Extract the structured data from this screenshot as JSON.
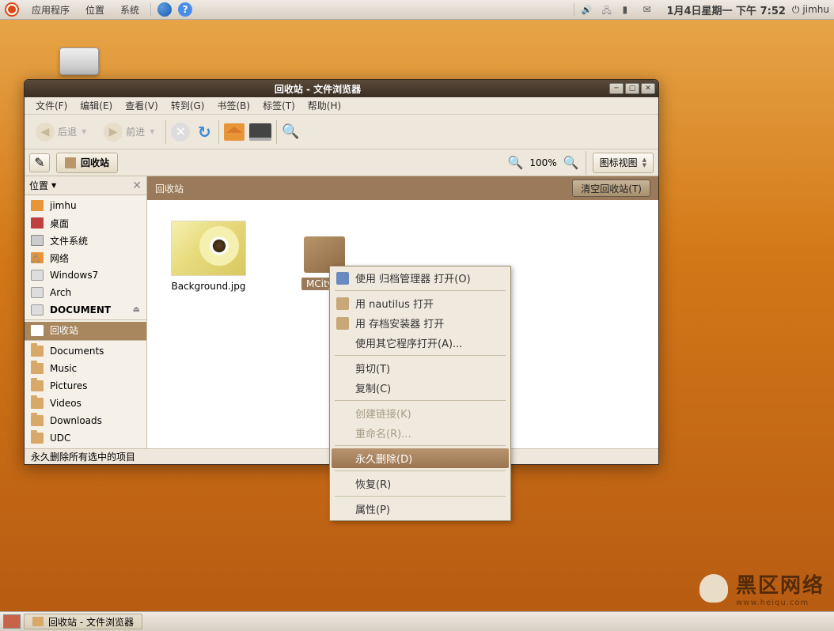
{
  "top_panel": {
    "menus": [
      "应用程序",
      "位置",
      "系统"
    ],
    "clock": "1月4日星期一 下午 7:52",
    "user": "jimhu"
  },
  "window": {
    "title": "回收站 - 文件浏览器",
    "menubar": {
      "file": "文件(F)",
      "edit": "编辑(E)",
      "view": "查看(V)",
      "go": "转到(G)",
      "bookmarks": "书签(B)",
      "tabs": "标签(T)",
      "help": "帮助(H)"
    },
    "toolbar": {
      "back": "后退",
      "forward": "前进"
    },
    "location_button": "回收站",
    "zoom": "100%",
    "view_mode": "图标视图",
    "sidebar": {
      "header": "位置",
      "items": [
        {
          "label": "jimhu",
          "icon": "home"
        },
        {
          "label": "桌面",
          "icon": "desk"
        },
        {
          "label": "文件系统",
          "icon": "fs"
        },
        {
          "label": "网络",
          "icon": "net"
        },
        {
          "label": "Windows7",
          "icon": "disk"
        },
        {
          "label": "Arch",
          "icon": "disk"
        },
        {
          "label": "DOCUMENT",
          "icon": "disk",
          "bold": true,
          "eject": true,
          "sep_after": true
        },
        {
          "label": "回收站",
          "icon": "trash",
          "selected": true,
          "sep_after": true
        },
        {
          "label": "Documents",
          "icon": "folder"
        },
        {
          "label": "Music",
          "icon": "folder"
        },
        {
          "label": "Pictures",
          "icon": "folder"
        },
        {
          "label": "Videos",
          "icon": "folder"
        },
        {
          "label": "Downloads",
          "icon": "folder"
        },
        {
          "label": "UDC",
          "icon": "folder"
        }
      ]
    },
    "content": {
      "breadcrumb": "回收站",
      "empty_button": "清空回收站(T)",
      "files": [
        {
          "name": "Background.jpg",
          "type": "image"
        },
        {
          "name": "MCity-B",
          "type": "package",
          "selected": true
        }
      ]
    },
    "statusbar": "永久删除所有选中的项目"
  },
  "context_menu": {
    "items": [
      {
        "label": "使用 归档管理器 打开(O)",
        "icon": "arc"
      },
      {
        "sep": true
      },
      {
        "label": "用 nautilus 打开",
        "icon": "box"
      },
      {
        "label": "用 存档安装器 打开",
        "icon": "box"
      },
      {
        "label": "使用其它程序打开(A)..."
      },
      {
        "sep": true
      },
      {
        "label": "剪切(T)"
      },
      {
        "label": "复制(C)"
      },
      {
        "sep": true
      },
      {
        "label": "创建链接(K)",
        "disabled": true
      },
      {
        "label": "重命名(R)...",
        "disabled": true
      },
      {
        "sep": true
      },
      {
        "label": "永久删除(D)",
        "selected": true
      },
      {
        "sep": true
      },
      {
        "label": "恢复(R)"
      },
      {
        "sep": true
      },
      {
        "label": "属性(P)"
      }
    ]
  },
  "bottom_panel": {
    "task": "回收站 - 文件浏览器"
  },
  "watermark": {
    "main": "黑区网络",
    "sub": "www.heiqu.com"
  }
}
